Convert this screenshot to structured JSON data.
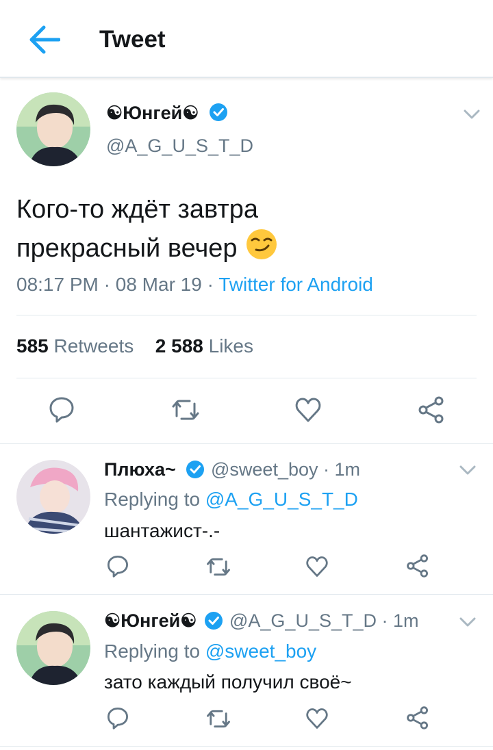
{
  "header": {
    "title": "Tweet",
    "back_icon": "arrow-left-icon"
  },
  "main_tweet": {
    "display_name": "☯Юнгей☯",
    "handle": "@A_G_U_S_T_D",
    "text_line1": "Кого-то ждёт завтра",
    "text_line2": "прекрасный вечер",
    "emoji": "😏",
    "time": "08:17 PM",
    "date": "08 Mar 19",
    "client": "Twitter for Android",
    "retweets_count": "585",
    "retweets_label": "Retweets",
    "likes_count": "2 588",
    "likes_label": "Likes"
  },
  "replies": [
    {
      "display_name": "Плюха~",
      "handle": "@sweet_boy",
      "time": "1m",
      "replying_label": "Replying to",
      "replying_to": "@A_G_U_S_T_D",
      "text": "шантажист-.-"
    },
    {
      "display_name": "☯Юнгей☯",
      "handle": "@A_G_U_S_T_D",
      "time": "1m",
      "replying_label": "Replying to",
      "replying_to": "@sweet_boy",
      "text": "зато каждый получил своё~"
    }
  ],
  "colors": {
    "accent": "#1da1f2",
    "text": "#14171a",
    "muted": "#657786",
    "divider": "#e1e8ed"
  },
  "icons": [
    "reply-icon",
    "retweet-icon",
    "like-icon",
    "share-icon",
    "chevron-down-icon",
    "verified-badge-icon"
  ]
}
